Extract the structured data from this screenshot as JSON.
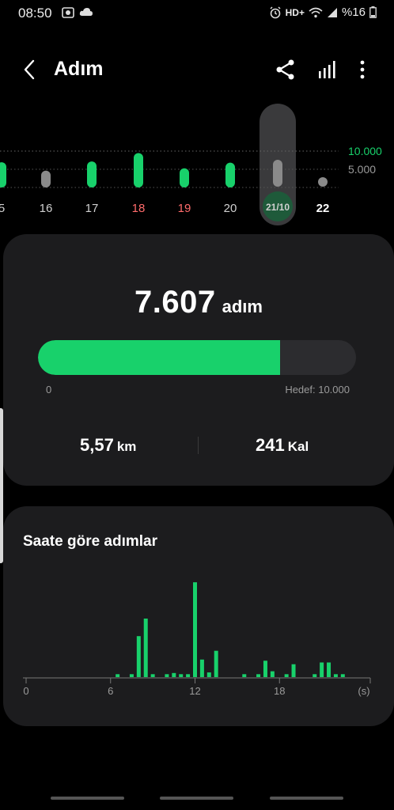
{
  "status_bar": {
    "time": "08:50",
    "network": "HD+",
    "battery": "%16"
  },
  "app_bar": {
    "title": "Adım",
    "icons": [
      "back-icon",
      "share-icon",
      "bar-chart-icon",
      "more-vertical-icon"
    ]
  },
  "daily_chart": {
    "goal_line_label": "10.000",
    "mid_line_label": "5.000",
    "days": [
      {
        "label": "5",
        "value": 6300,
        "status": "goal"
      },
      {
        "label": "16",
        "value": 4200,
        "status": "below"
      },
      {
        "label": "17",
        "value": 6500,
        "status": "goal"
      },
      {
        "label": "18",
        "value": 8600,
        "status": "goal-weekend"
      },
      {
        "label": "19",
        "value": 4800,
        "status": "goal-weekend"
      },
      {
        "label": "20",
        "value": 6200,
        "status": "goal"
      },
      {
        "label": "21/10",
        "value": 3300,
        "status": "selected"
      },
      {
        "label": "22",
        "value": 0,
        "status": "today"
      }
    ],
    "colors": {
      "goal": "#18d16b",
      "below": "#8a8a8a",
      "weekend_label": "#ff6b6b",
      "goal_label": "#18d16b"
    }
  },
  "summary": {
    "steps": "7.607",
    "steps_unit": "adım",
    "progress_fraction": 0.7607,
    "progress_min": "0",
    "progress_goal": "Hedef: 10.000",
    "distance_value": "5,57",
    "distance_unit": "km",
    "calories_value": "241",
    "calories_unit": "Kal"
  },
  "hourly": {
    "title": "Saate göre adımlar",
    "x_tick_labels": [
      "0",
      "6",
      "12",
      "18",
      "(s)"
    ],
    "chart_data": {
      "type": "bar",
      "xlabel": "(s)",
      "x_range": [
        0,
        24
      ],
      "x": [
        6.5,
        7.5,
        8.0,
        8.5,
        9.0,
        10.0,
        10.5,
        11.0,
        11.5,
        12.0,
        12.5,
        13.0,
        13.5,
        15.5,
        16.5,
        17.0,
        17.5,
        18.5,
        19.0,
        20.5,
        21.0,
        21.5,
        22.0,
        22.5
      ],
      "values": [
        5,
        5,
        70,
        100,
        5,
        5,
        7,
        5,
        5,
        162,
        30,
        8,
        45,
        5,
        5,
        28,
        10,
        5,
        22,
        5,
        25,
        25,
        5,
        5
      ]
    }
  }
}
